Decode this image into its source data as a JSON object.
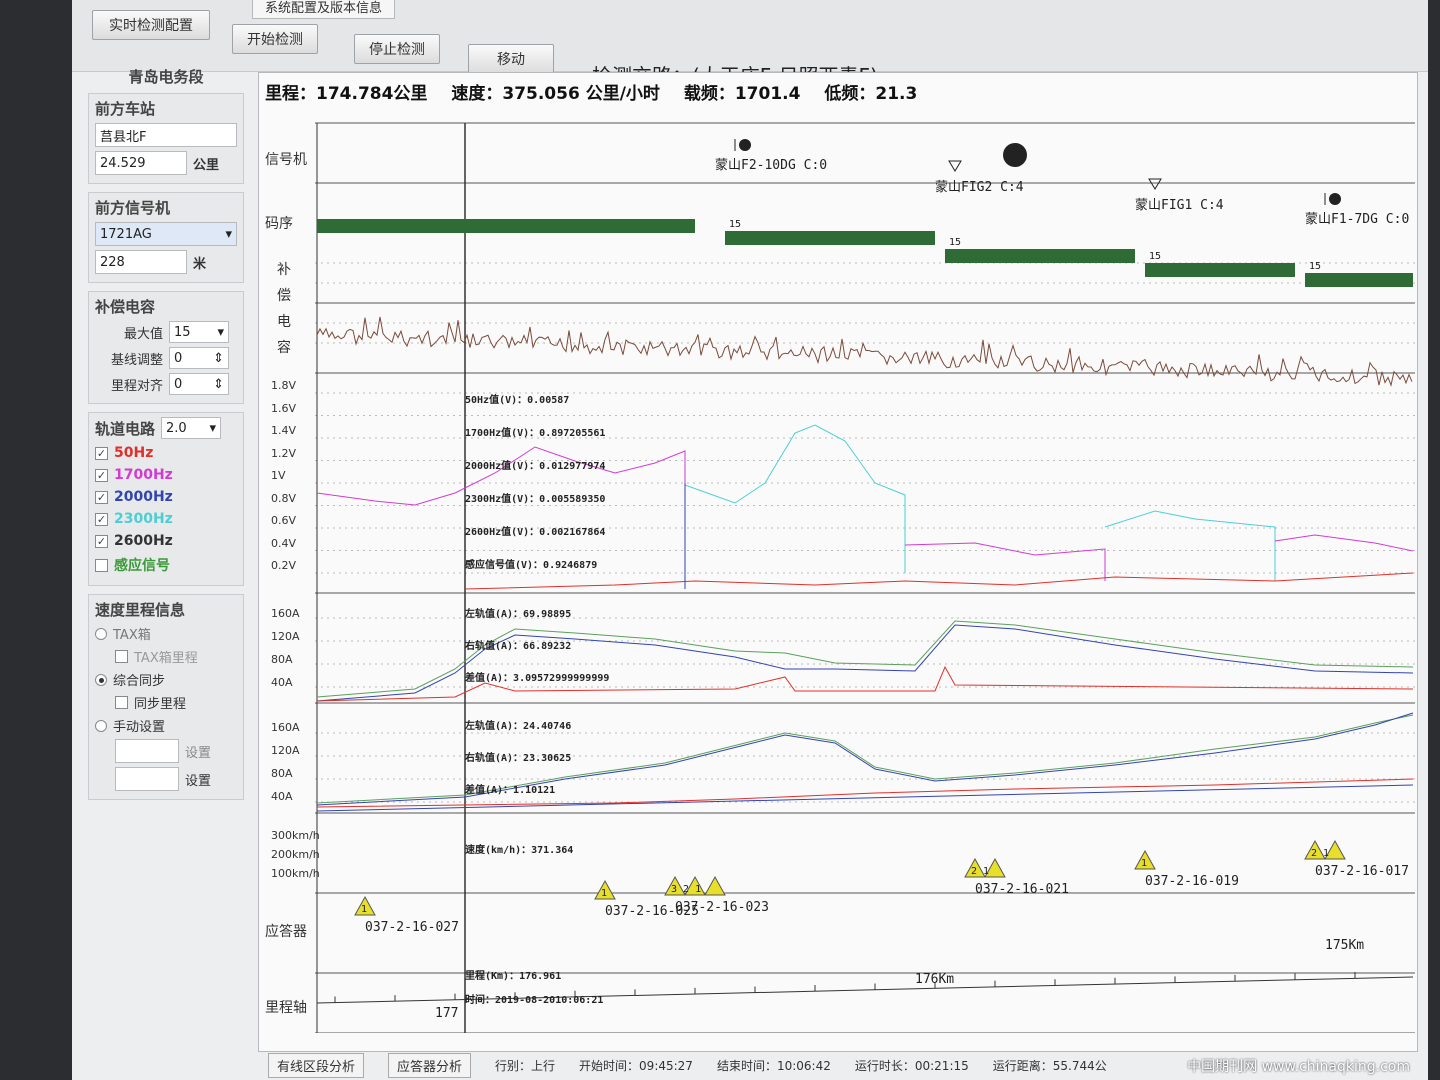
{
  "toolbar": {
    "btn_realtime": "实时检测配置",
    "btn_start": "开始检测",
    "btn_stop": "停止检测",
    "btn_move": "移动",
    "tab_version": "系统配置及版本信息"
  },
  "route": {
    "label": "检测交路：",
    "value": "(大王庄F-日照西青F)"
  },
  "left": {
    "bureau": "青岛电务段",
    "front_station_title": "前方车站",
    "front_station": "莒县北F",
    "front_station_dist": "24.529",
    "front_station_unit": "公里",
    "front_signal_title": "前方信号机",
    "front_signal": "1721AG",
    "front_signal_dist": "228",
    "front_signal_unit": "米",
    "comp_title": "补偿电容",
    "max_label": "最大值",
    "max_value": "15",
    "baseline_label": "基线调整",
    "baseline_value": "0",
    "mileage_align_label": "里程对齐",
    "mileage_align_value": "0",
    "track_title": "轨道电路",
    "track_value": "2.0",
    "freqs": [
      {
        "label": "50Hz",
        "color": "#e0302a",
        "checked": true
      },
      {
        "label": "1700Hz",
        "color": "#d23bd2",
        "checked": true
      },
      {
        "label": "2000Hz",
        "color": "#3344b0",
        "checked": true
      },
      {
        "label": "2300Hz",
        "color": "#4ccfd3",
        "checked": true
      },
      {
        "label": "2600Hz",
        "color": "#333333",
        "checked": true
      },
      {
        "label": "感应信号",
        "color": "#3a9a3a",
        "checked": false
      }
    ],
    "speed_title": "速度里程信息",
    "tax_label": "TAX箱",
    "tax_mileage_label": "TAX箱里程",
    "sync_label": "综合同步",
    "sync_mileage_label": "同步里程",
    "manual_label": "手动设置",
    "set_label_1": "设置",
    "set_label_2": "设置"
  },
  "status": {
    "mileage": "里程：174.784公里",
    "speed": "速度：375.056 公里/小时",
    "carrier": "载频：1701.4",
    "low": "低频：21.3"
  },
  "rows": {
    "signal": "信号机",
    "code": "码序",
    "comp": [
      "补",
      "偿",
      "电",
      "容"
    ],
    "transponder": "应答器",
    "mileage_axis": "里程轴"
  },
  "signals": [
    {
      "name": "蒙山F2-10DG C:0"
    },
    {
      "name": "蒙山FIG2 C:4"
    },
    {
      "name": "蒙山FIG1 C:4"
    },
    {
      "name": "蒙山F1-7DG C:0"
    }
  ],
  "code_labels": [
    "15",
    "15",
    "15",
    "15"
  ],
  "voltage_axis": [
    "1.8V",
    "1.6V",
    "1.4V",
    "1.2V",
    "1V",
    "0.8V",
    "0.6V",
    "0.4V",
    "0.2V"
  ],
  "voltage_readouts": [
    "50Hz值(V)：0.00587",
    "1700Hz值(V)：0.897205561",
    "2000Hz值(V)：0.012977974",
    "2300Hz值(V)：0.005589350",
    "2600Hz值(V)：0.002167864",
    "感应信号值(V)：0.9246879"
  ],
  "current_axis": [
    "160A",
    "120A",
    "80A",
    "40A"
  ],
  "current1_readouts": [
    "左轨值(A)：69.98895",
    "右轨值(A)：66.89232",
    "差值(A)：3.09572999999999"
  ],
  "current2_readouts": [
    "左轨值(A)：24.40746",
    "右轨值(A)：23.30625",
    "差值(A)：1.10121"
  ],
  "speed_axis": [
    "300km/h",
    "200km/h",
    "100km/h"
  ],
  "speed_readout": "速度(km/h)：371.364",
  "transponders": [
    {
      "count": "1",
      "id": "037-2-16-027"
    },
    {
      "count": "1",
      "id": "037-2-16-025"
    },
    {
      "count": "3 2 1",
      "id": "037-2-16-023"
    },
    {
      "count": "2 1",
      "id": "037-2-16-021"
    },
    {
      "count": "1",
      "id": "037-2-16-019"
    },
    {
      "count": "2 1",
      "id": "037-2-16-017"
    }
  ],
  "mileage_axis_labels": {
    "km177": "177",
    "km176": "176Km",
    "km175": "175Km"
  },
  "mileage_readout": "里程(Km)：176.961",
  "time_readout": "时间：2019-08-2010:06:21",
  "bottom": {
    "tab1": "有线区段分析",
    "tab2": "应答器分析",
    "direction": "行别：上行",
    "start": "开始时间：09:45:27",
    "end": "结束时间：10:06:42",
    "duration": "运行时长：00:21:15",
    "distance": "运行距离：55.744公"
  },
  "watermark": "中国期刊网 www.chinaqking.com",
  "colors": {
    "brown": "#7a4a3a",
    "magenta": "#d23bd2",
    "cyan": "#4ccfd3",
    "red": "#e0302a",
    "blue": "#3344b0",
    "green": "#5aa05a",
    "code_green": "#2f6b34",
    "gray": "#666"
  }
}
